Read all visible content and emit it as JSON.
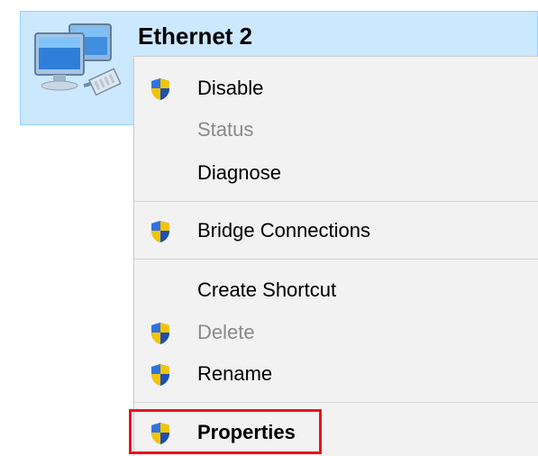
{
  "adapter": {
    "name": "Ethernet 2",
    "icon": "network-adapter-icon"
  },
  "context_menu": {
    "items": [
      {
        "label": "Disable",
        "icon": "uac-shield-icon",
        "enabled": true
      },
      {
        "label": "Status",
        "icon": null,
        "enabled": false
      },
      {
        "label": "Diagnose",
        "icon": null,
        "enabled": true
      },
      {
        "label": "Bridge Connections",
        "icon": "uac-shield-icon",
        "enabled": true
      },
      {
        "label": "Create Shortcut",
        "icon": null,
        "enabled": true
      },
      {
        "label": "Delete",
        "icon": "uac-shield-icon",
        "enabled": false
      },
      {
        "label": "Rename",
        "icon": "uac-shield-icon",
        "enabled": true
      },
      {
        "label": "Properties",
        "icon": "uac-shield-icon",
        "enabled": true,
        "default": true,
        "highlighted": true
      }
    ]
  },
  "colors": {
    "selection_bg": "#cce8ff",
    "menu_bg": "#f2f2f2",
    "disabled_text": "#8a8a8a",
    "highlight_border": "#e8141e"
  }
}
